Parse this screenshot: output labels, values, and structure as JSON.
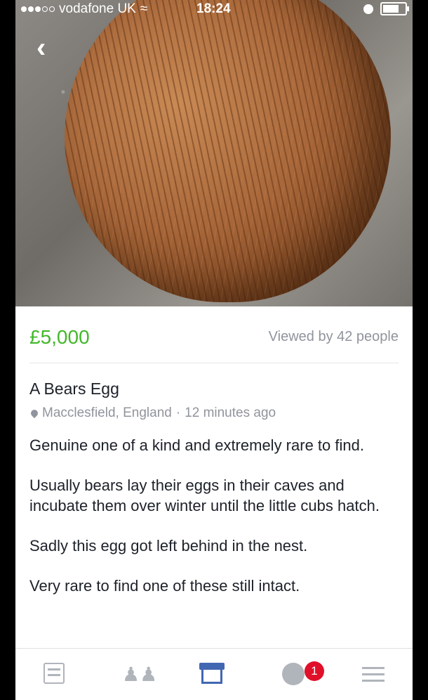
{
  "status_bar": {
    "carrier": "vodafone UK",
    "time": "18:24",
    "signal_bars_filled": 3,
    "signal_bars_total": 5
  },
  "listing": {
    "price": "£5,000",
    "views": "Viewed by 42 people",
    "title": "A Bears Egg",
    "location": "Macclesfield, England",
    "separator": "·",
    "posted": "12 minutes ago",
    "paragraphs": [
      "Genuine one of a kind and extremely rare to find.",
      "Usually bears lay their eggs in their caves and incubate them over winter until the little cubs hatch.",
      "Sadly this egg got left behind in the nest.",
      "Very rare to find one of these still intact."
    ]
  },
  "tab_bar": {
    "notifications_badge": "1",
    "active_tab": "marketplace"
  },
  "colors": {
    "price": "#42b72a",
    "active_tab": "#4267b2",
    "badge": "#e0102a",
    "muted": "#90949c"
  }
}
